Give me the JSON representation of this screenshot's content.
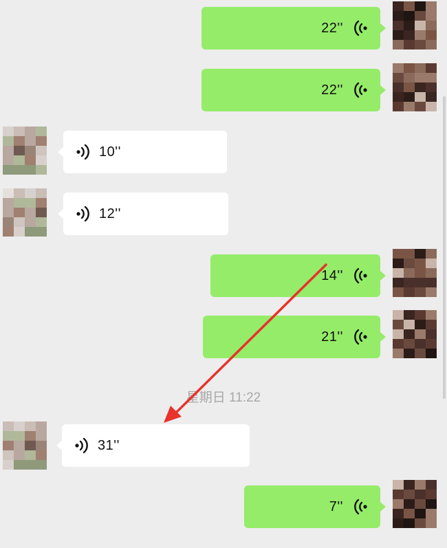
{
  "messages": [
    {
      "side": "out",
      "duration": "22''",
      "icon": "voice-wave-icon"
    },
    {
      "side": "out",
      "duration": "22''",
      "icon": "voice-wave-icon"
    },
    {
      "side": "in",
      "duration": "10''",
      "icon": "voice-wave-icon"
    },
    {
      "side": "in",
      "duration": "12''",
      "icon": "voice-wave-icon"
    },
    {
      "side": "out",
      "duration": "14''",
      "icon": "voice-wave-icon"
    },
    {
      "side": "out",
      "duration": "21''",
      "icon": "voice-wave-icon"
    },
    {
      "side": "in",
      "duration": "31''",
      "icon": "voice-wave-icon"
    },
    {
      "side": "out",
      "duration": "7''",
      "icon": "voice-wave-icon"
    }
  ],
  "timestamp": "星期日 11:22",
  "colors": {
    "background": "#ededed",
    "outgoing_bubble": "#95ec69",
    "incoming_bubble": "#ffffff",
    "annotation_arrow": "#e8322b",
    "timestamp_text": "#a8a8a8"
  }
}
